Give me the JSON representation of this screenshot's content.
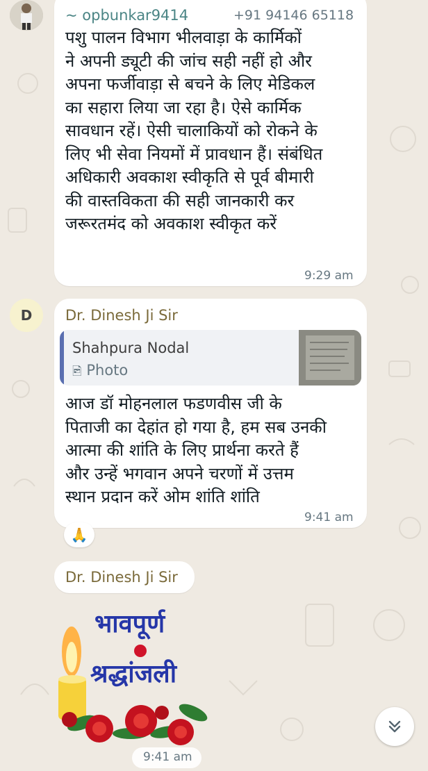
{
  "colors": {
    "chat_background": "#efeae2",
    "bubble": "#ffffff",
    "sender_teal": "#4b8585",
    "sender_brown": "#7a6a3a",
    "quote_accent": "#5a6fb0",
    "sticker_title": "#2536a8",
    "timestamp": "#667781"
  },
  "messages": [
    {
      "sender": "~ opbunkar9414",
      "phone": "+91 94146 65118",
      "text": "पशु पालन विभाग भीलवाड़ा के कार्मिकों\nने  अपनी ड्यूटी  की जांच सही नहीं हो और\nअपना फर्जीवाड़ा से बचने के लिए मेडिकल\nका सहारा लिया जा रहा है। ऐसे कार्मिक\nसावधान रहें। ऐसी चालाकियों को रोकने के\nलिए भी सेवा नियमों में प्रावधान हैं। संबंधित\nअधिकारी अवकाश स्वीकृति से पूर्व बीमारी\nकी वास्तविकता की सही जानकारी कर\nजरूरतमंद को अवकाश स्वीकृत करें",
      "time": "9:29 am"
    },
    {
      "avatar_initial": "D",
      "sender": "Dr. Dinesh Ji Sir",
      "quoted": {
        "name": "Shahpura Nodal",
        "type_label": "Photo",
        "type_icon": "photo-icon"
      },
      "text": "आज  डॉ मोहनलाल  फडणवीस जी के\nपिताजी का देहांत हो गया है, हम सब उनकी\nआत्मा की शांति के लिए प्रार्थना करते हैं\nऔर उन्हें भगवान अपने चरणों में उत्तम\nस्थान प्रदान करें  ओम शांति शांति",
      "time": "9:41 am",
      "reaction": "🙏"
    },
    {
      "sender": "Dr. Dinesh Ji Sir",
      "sticker": {
        "line1": "भावपूर्ण",
        "line2": "श्रद्धांजली",
        "images": [
          "candle",
          "roses"
        ]
      },
      "time": "9:41 am"
    }
  ],
  "scroll_button": {
    "icon": "double-chevron-down-icon"
  }
}
